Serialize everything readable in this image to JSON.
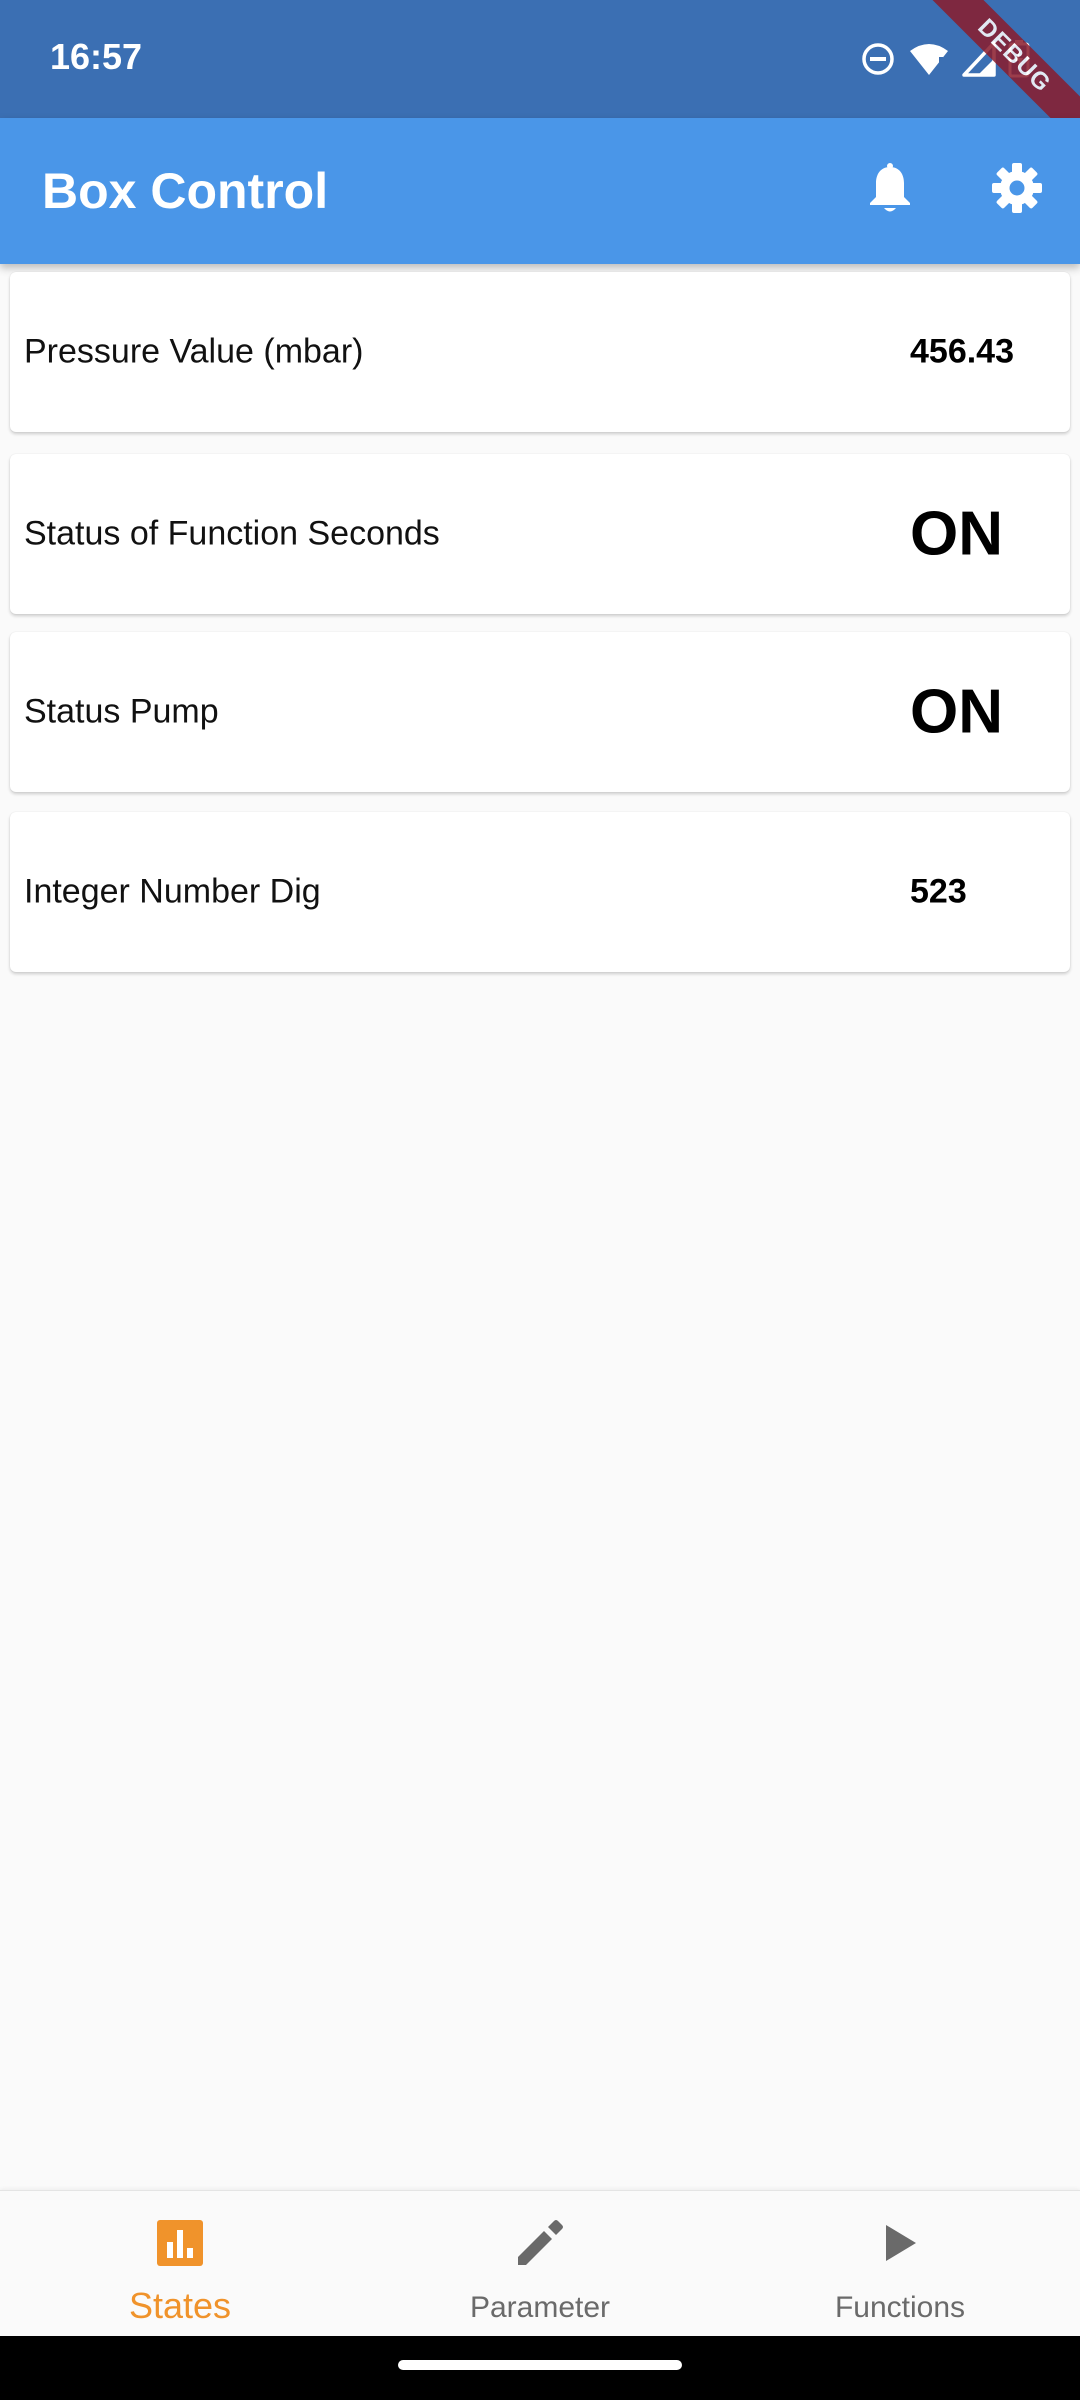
{
  "status_bar": {
    "time": "16:57",
    "icons": [
      "do-not-disturb-icon",
      "wifi-icon",
      "signal-icon",
      "battery-icon"
    ],
    "debug_banner": "DEBUG"
  },
  "app_bar": {
    "title": "Box Control",
    "actions": [
      "bell-icon",
      "gear-icon"
    ]
  },
  "cards": [
    {
      "label": "Pressure Value (mbar)",
      "value": "456.43"
    },
    {
      "label": "Status of Function Seconds",
      "value": "ON"
    },
    {
      "label": "Status Pump",
      "value": "ON"
    },
    {
      "label": "Integer Number Dig",
      "value": "523"
    }
  ],
  "bottom_nav": {
    "items": [
      {
        "label": "States",
        "icon": "bar-chart-icon",
        "active": true
      },
      {
        "label": "Parameter",
        "icon": "pencil-icon",
        "active": false
      },
      {
        "label": "Functions",
        "icon": "play-icon",
        "active": false
      }
    ]
  },
  "colors": {
    "status_bar": "#3b6fb3",
    "app_bar": "#4a96e8",
    "active_nav": "#f0932b",
    "inactive_nav": "#6a6a6a",
    "background": "#fafafa"
  }
}
